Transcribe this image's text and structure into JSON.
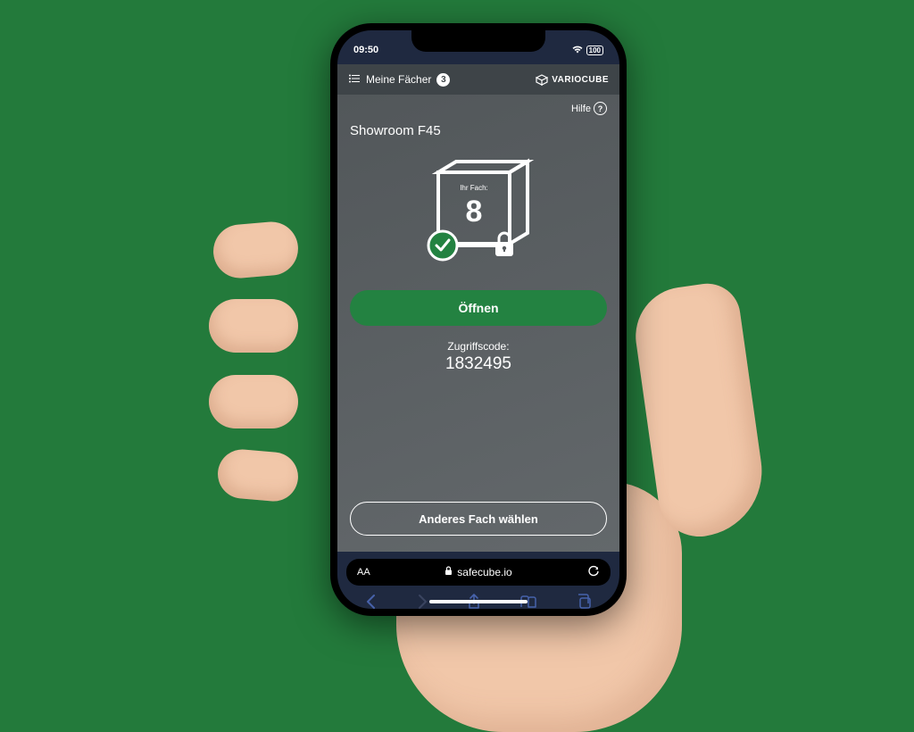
{
  "status_bar": {
    "time": "09:50",
    "battery": "100"
  },
  "app_header": {
    "menu_label": "Meine Fächer",
    "badge_count": "3",
    "brand": "VARIOCUBE"
  },
  "content": {
    "help_label": "Hilfe",
    "title": "Showroom F45",
    "box_label": "Ihr Fach:",
    "box_number": "8",
    "open_button": "Öffnen",
    "code_label": "Zugriffscode:",
    "code_value": "1832495",
    "other_button": "Anderes Fach wählen"
  },
  "browser": {
    "aa": "AA",
    "url": "safecube.io"
  }
}
